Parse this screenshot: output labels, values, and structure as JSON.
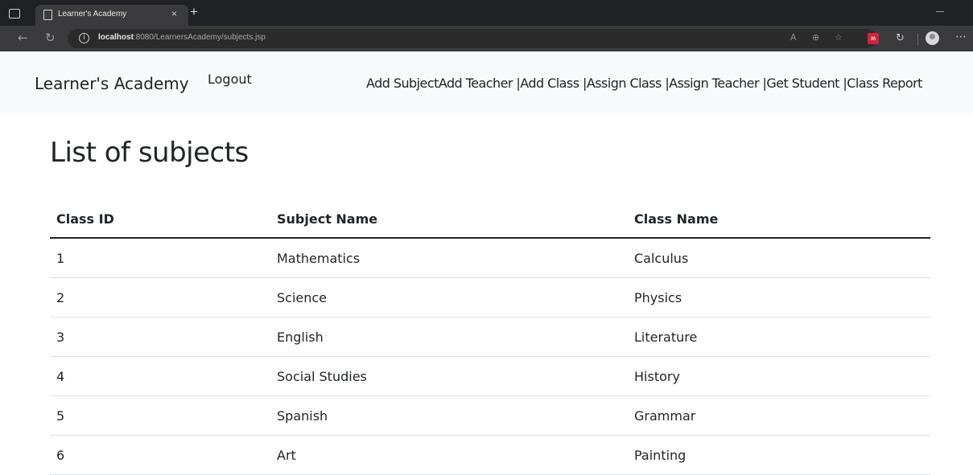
{
  "browser": {
    "tab_title": "Learner's Academy",
    "tab_close": "×",
    "new_tab": "+",
    "url_host": "localhost",
    "url_rest": ":8080/LearnersAcademy/subjects.jsp",
    "ext_label": "ʍ"
  },
  "navbar": {
    "brand": "Learner's Academy",
    "logout": "Logout",
    "links": "Add SubjectAdd Teacher |Add Class |Assign Class |Assign Teacher |Get Student |Class Report"
  },
  "page": {
    "title": "List of subjects",
    "columns": [
      "Class ID",
      "Subject Name",
      "Class Name"
    ],
    "rows": [
      [
        "1",
        "Mathematics",
        "Calculus"
      ],
      [
        "2",
        "Science",
        "Physics"
      ],
      [
        "3",
        "English",
        "Literature"
      ],
      [
        "4",
        "Social Studies",
        "History"
      ],
      [
        "5",
        "Spanish",
        "Grammar"
      ],
      [
        "6",
        "Art",
        "Painting"
      ]
    ]
  }
}
